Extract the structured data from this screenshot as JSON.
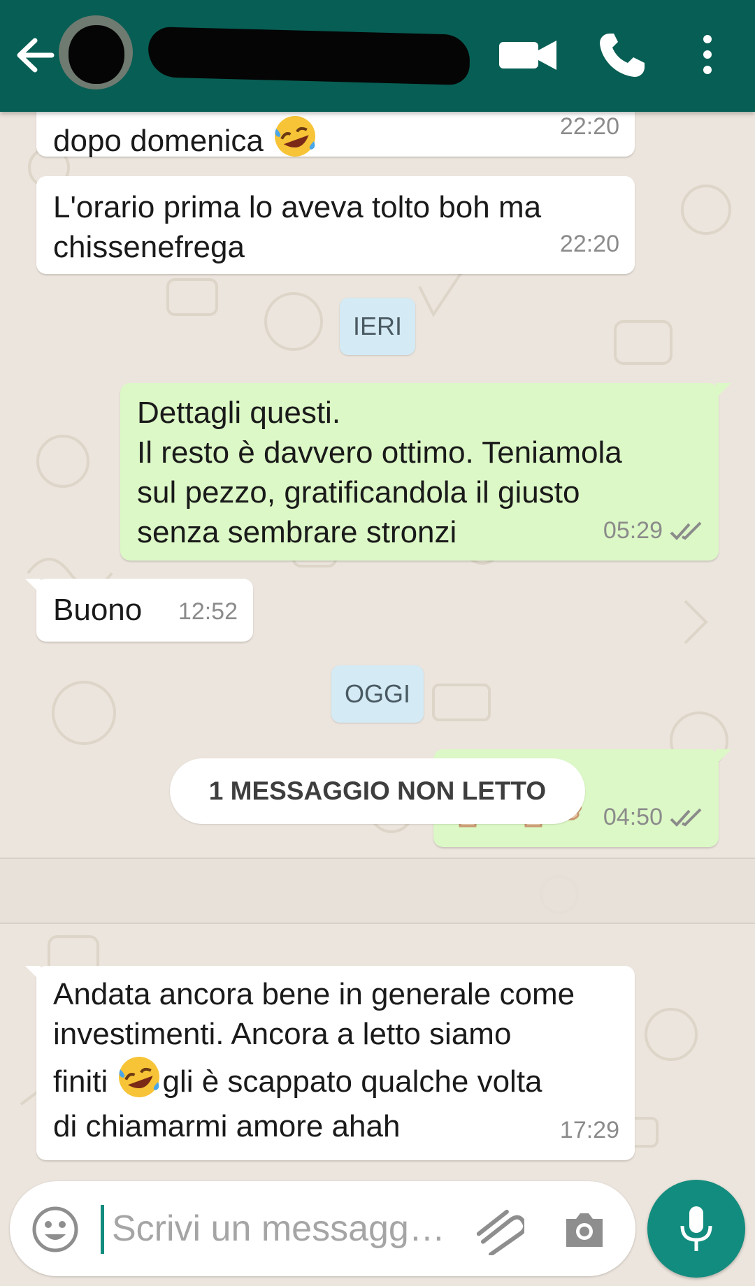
{
  "colors": {
    "header": "#075e54",
    "outgoing_bubble": "#dcf8c6",
    "incoming_bubble": "#ffffff",
    "accent": "#128c7e",
    "read_ticks": "#8b8b8b"
  },
  "header": {
    "icons": [
      "back-arrow-icon",
      "video-call-icon",
      "phone-icon",
      "more-vert-icon"
    ]
  },
  "messages": [
    {
      "dir": "in",
      "text": "dopo domenica",
      "emoji": "rolling-on-floor-laughing",
      "time": "22:20"
    },
    {
      "dir": "in",
      "text": "L'orario prima lo aveva tolto boh ma\nchissenefrega",
      "time": "22:20"
    },
    {
      "dir": "out",
      "text": "Dettagli questi.\nIl resto è davvero ottimo. Teniamola\nsul pezzo, gratificandola il giusto\nsenza sembrare stronzi",
      "time": "05:29",
      "status": "read"
    },
    {
      "dir": "in",
      "text": "Buono",
      "time": "12:52"
    },
    {
      "dir": "out",
      "emoji": "thumbs-up-x2",
      "time": "04:50",
      "status": "read"
    },
    {
      "dir": "in",
      "text_a": "Andata ancora bene in generale come\ninvestimenti.  Ancora   a letto siamo",
      "text_b": "finiti ",
      "emoji": "rolling-on-floor-laughing",
      "text_c": "gli è scappato qualche volta",
      "text_d": "di chiamarmi amore ahah",
      "time": "17:29"
    }
  ],
  "dates": {
    "yesterday": "IERI",
    "today": "OGGI"
  },
  "unread": "1 MESSAGGIO NON LETTO",
  "composer": {
    "placeholder": "Scrivi un messagg…",
    "icons": [
      "emoji-icon",
      "attach-icon",
      "camera-icon",
      "mic-icon"
    ]
  }
}
